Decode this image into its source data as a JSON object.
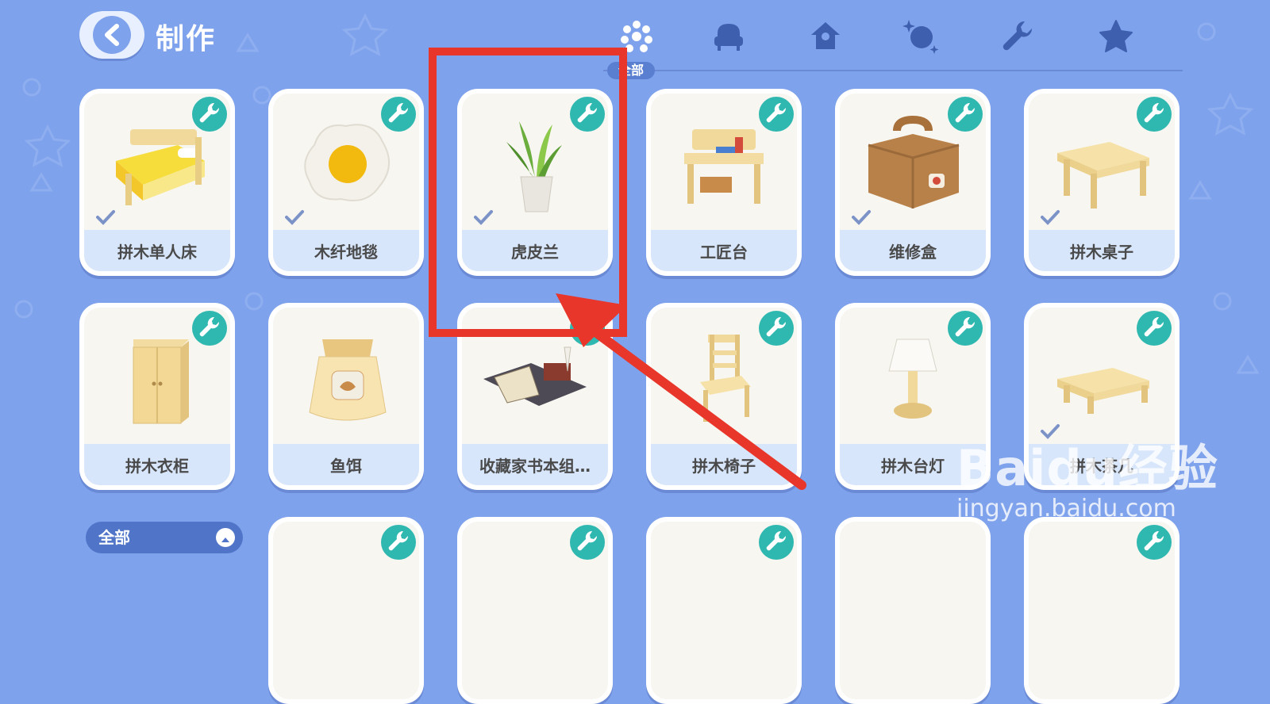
{
  "header": {
    "title": "制作",
    "category_badge": "全部"
  },
  "tabs": [
    {
      "icon": "grid-dots-icon"
    },
    {
      "icon": "armchair-icon"
    },
    {
      "icon": "house-icon"
    },
    {
      "icon": "sparkle-orb-icon"
    },
    {
      "icon": "wrench-icon"
    },
    {
      "icon": "star-icon"
    }
  ],
  "grid": {
    "row1": [
      {
        "label": "拼木单人床",
        "checked": true
      },
      {
        "label": "木纤地毯",
        "checked": true
      },
      {
        "label": "虎皮兰",
        "checked": true
      },
      {
        "label": "工匠台",
        "checked": false
      },
      {
        "label": "维修盒",
        "checked": true
      },
      {
        "label": "拼木桌子",
        "checked": true
      }
    ],
    "row2": [
      {
        "label": "拼木衣柜",
        "checked": false
      },
      {
        "label": "鱼饵",
        "checked": false
      },
      {
        "label": "收藏家书本组…",
        "checked": false
      },
      {
        "label": "拼木椅子",
        "checked": false
      },
      {
        "label": "拼木台灯",
        "checked": false
      },
      {
        "label": "拼木茶几",
        "checked": true
      }
    ]
  },
  "filter": {
    "label": "全部"
  },
  "watermark": {
    "brand": "Baidu经验",
    "url": "jingyan.baidu.com"
  },
  "colors": {
    "background": "#7fa2ec",
    "label_bar": "#d7e6fb",
    "badge_teal": "#2fb8b0",
    "annotation_red": "#e8362a"
  }
}
